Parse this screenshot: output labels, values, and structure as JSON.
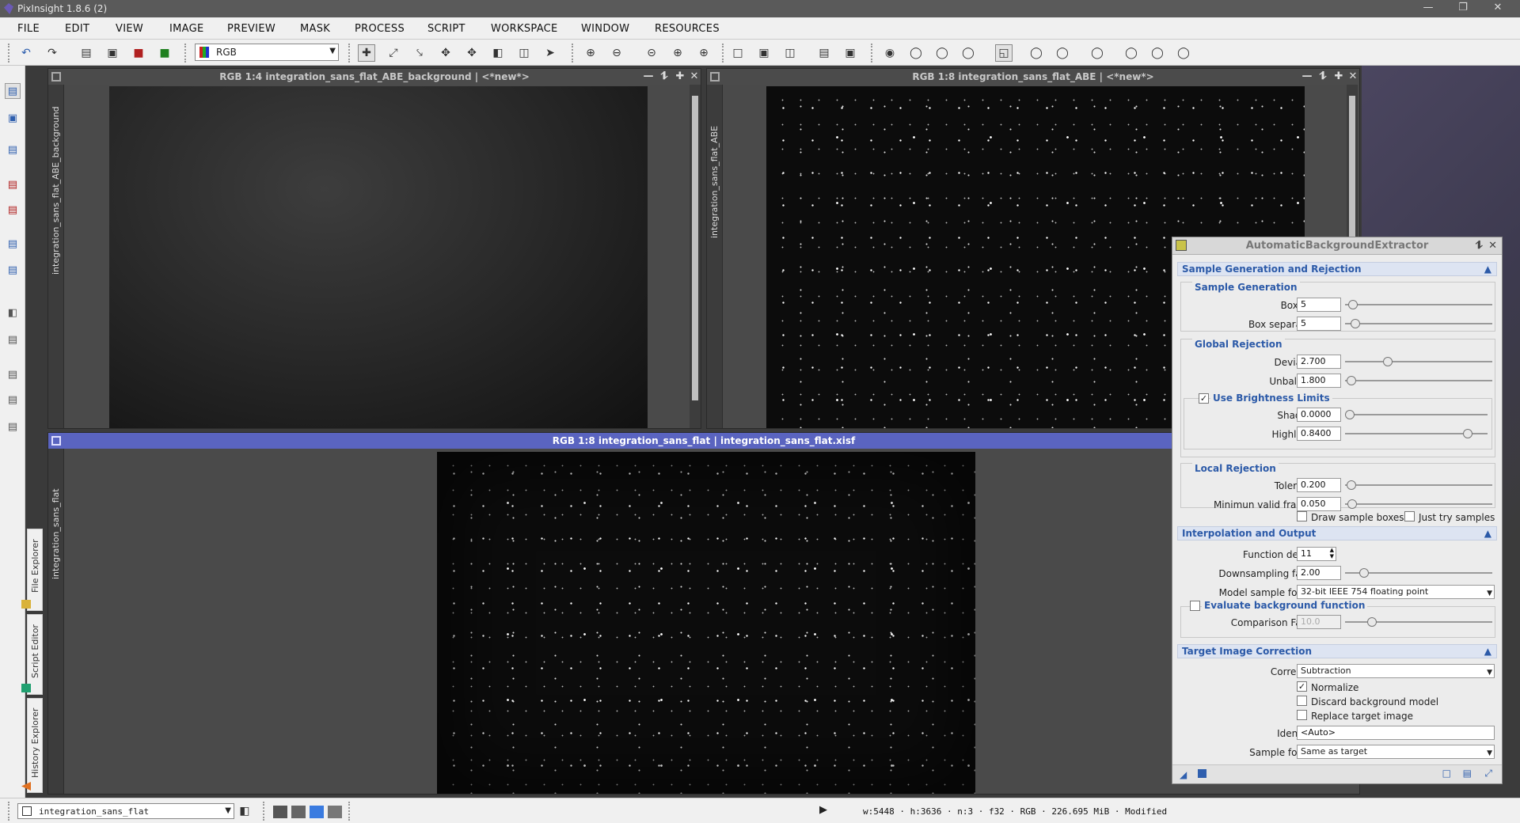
{
  "app": {
    "title": "PixInsight 1.8.6 (2)"
  },
  "menu": [
    "FILE",
    "EDIT",
    "VIEW",
    "IMAGE",
    "PREVIEW",
    "MASK",
    "PROCESS",
    "SCRIPT",
    "WORKSPACE",
    "WINDOW",
    "RESOURCES"
  ],
  "toolbar": {
    "channel_combo": "RGB"
  },
  "side_tabs": {
    "file_explorer": "File Explorer",
    "script_editor": "Script Editor",
    "history_explorer": "History Explorer"
  },
  "windows": {
    "background": {
      "title": "RGB 1:4 integration_sans_flat_ABE_background | <*new*>",
      "side_label": "integration_sans_flat_ABE_background"
    },
    "abe_result": {
      "title": "RGB 1:8 integration_sans_flat_ABE | <*new*>",
      "side_label": "integration_sans_flat_ABE"
    },
    "source": {
      "title": "RGB 1:8 integration_sans_flat | integration_sans_flat.xisf",
      "side_label": "integration_sans_flat"
    }
  },
  "abe": {
    "title": "AutomaticBackgroundExtractor",
    "sec_sample": "Sample Generation and Rejection",
    "grp_sample_gen": "Sample Generation",
    "box_size_label": "Box size:",
    "box_size": "5",
    "box_sep_label": "Box separation:",
    "box_sep": "5",
    "grp_global": "Global Rejection",
    "deviation_label": "Deviation:",
    "deviation": "2.700",
    "unbalance_label": "Unbalance:",
    "unbalance": "1.800",
    "use_brightness": "Use Brightness Limits",
    "shadows_label": "Shadows:",
    "shadows": "0.0000",
    "highlights_label": "Highlights:",
    "highlights": "0.8400",
    "grp_local": "Local Rejection",
    "tolerance_label": "Tolerance:",
    "tolerance": "0.200",
    "min_valid_label": "Minimun valid fraction:",
    "min_valid": "0.050",
    "draw_boxes": "Draw sample boxes",
    "just_try": "Just try samples",
    "sec_interp": "Interpolation and Output",
    "func_degree_label": "Function degree:",
    "func_degree": "11",
    "downsampling_label": "Downsampling factor:",
    "downsampling": "2.00",
    "model_format_label": "Model sample format:",
    "model_format": "32-bit IEEE 754 floating point",
    "eval_bg": "Evaluate background function",
    "comparison_label": "Comparison Factor:",
    "comparison": "10.0",
    "sec_target": "Target Image Correction",
    "correction_label": "Correction:",
    "correction": "Subtraction",
    "normalize": "Normalize",
    "discard": "Discard background model",
    "replace": "Replace target image",
    "identifier_label": "Identifier:",
    "identifier": "<Auto>",
    "sample_format_label": "Sample format:",
    "sample_format": "Same as target"
  },
  "status": {
    "view": "integration_sans_flat",
    "info": "w:5448 · h:3636 · n:3 · f32 · RGB · 226.695 MiB · Modified"
  },
  "colors": {
    "active_title": "#5a64c0",
    "section": "#2c5aa8"
  }
}
